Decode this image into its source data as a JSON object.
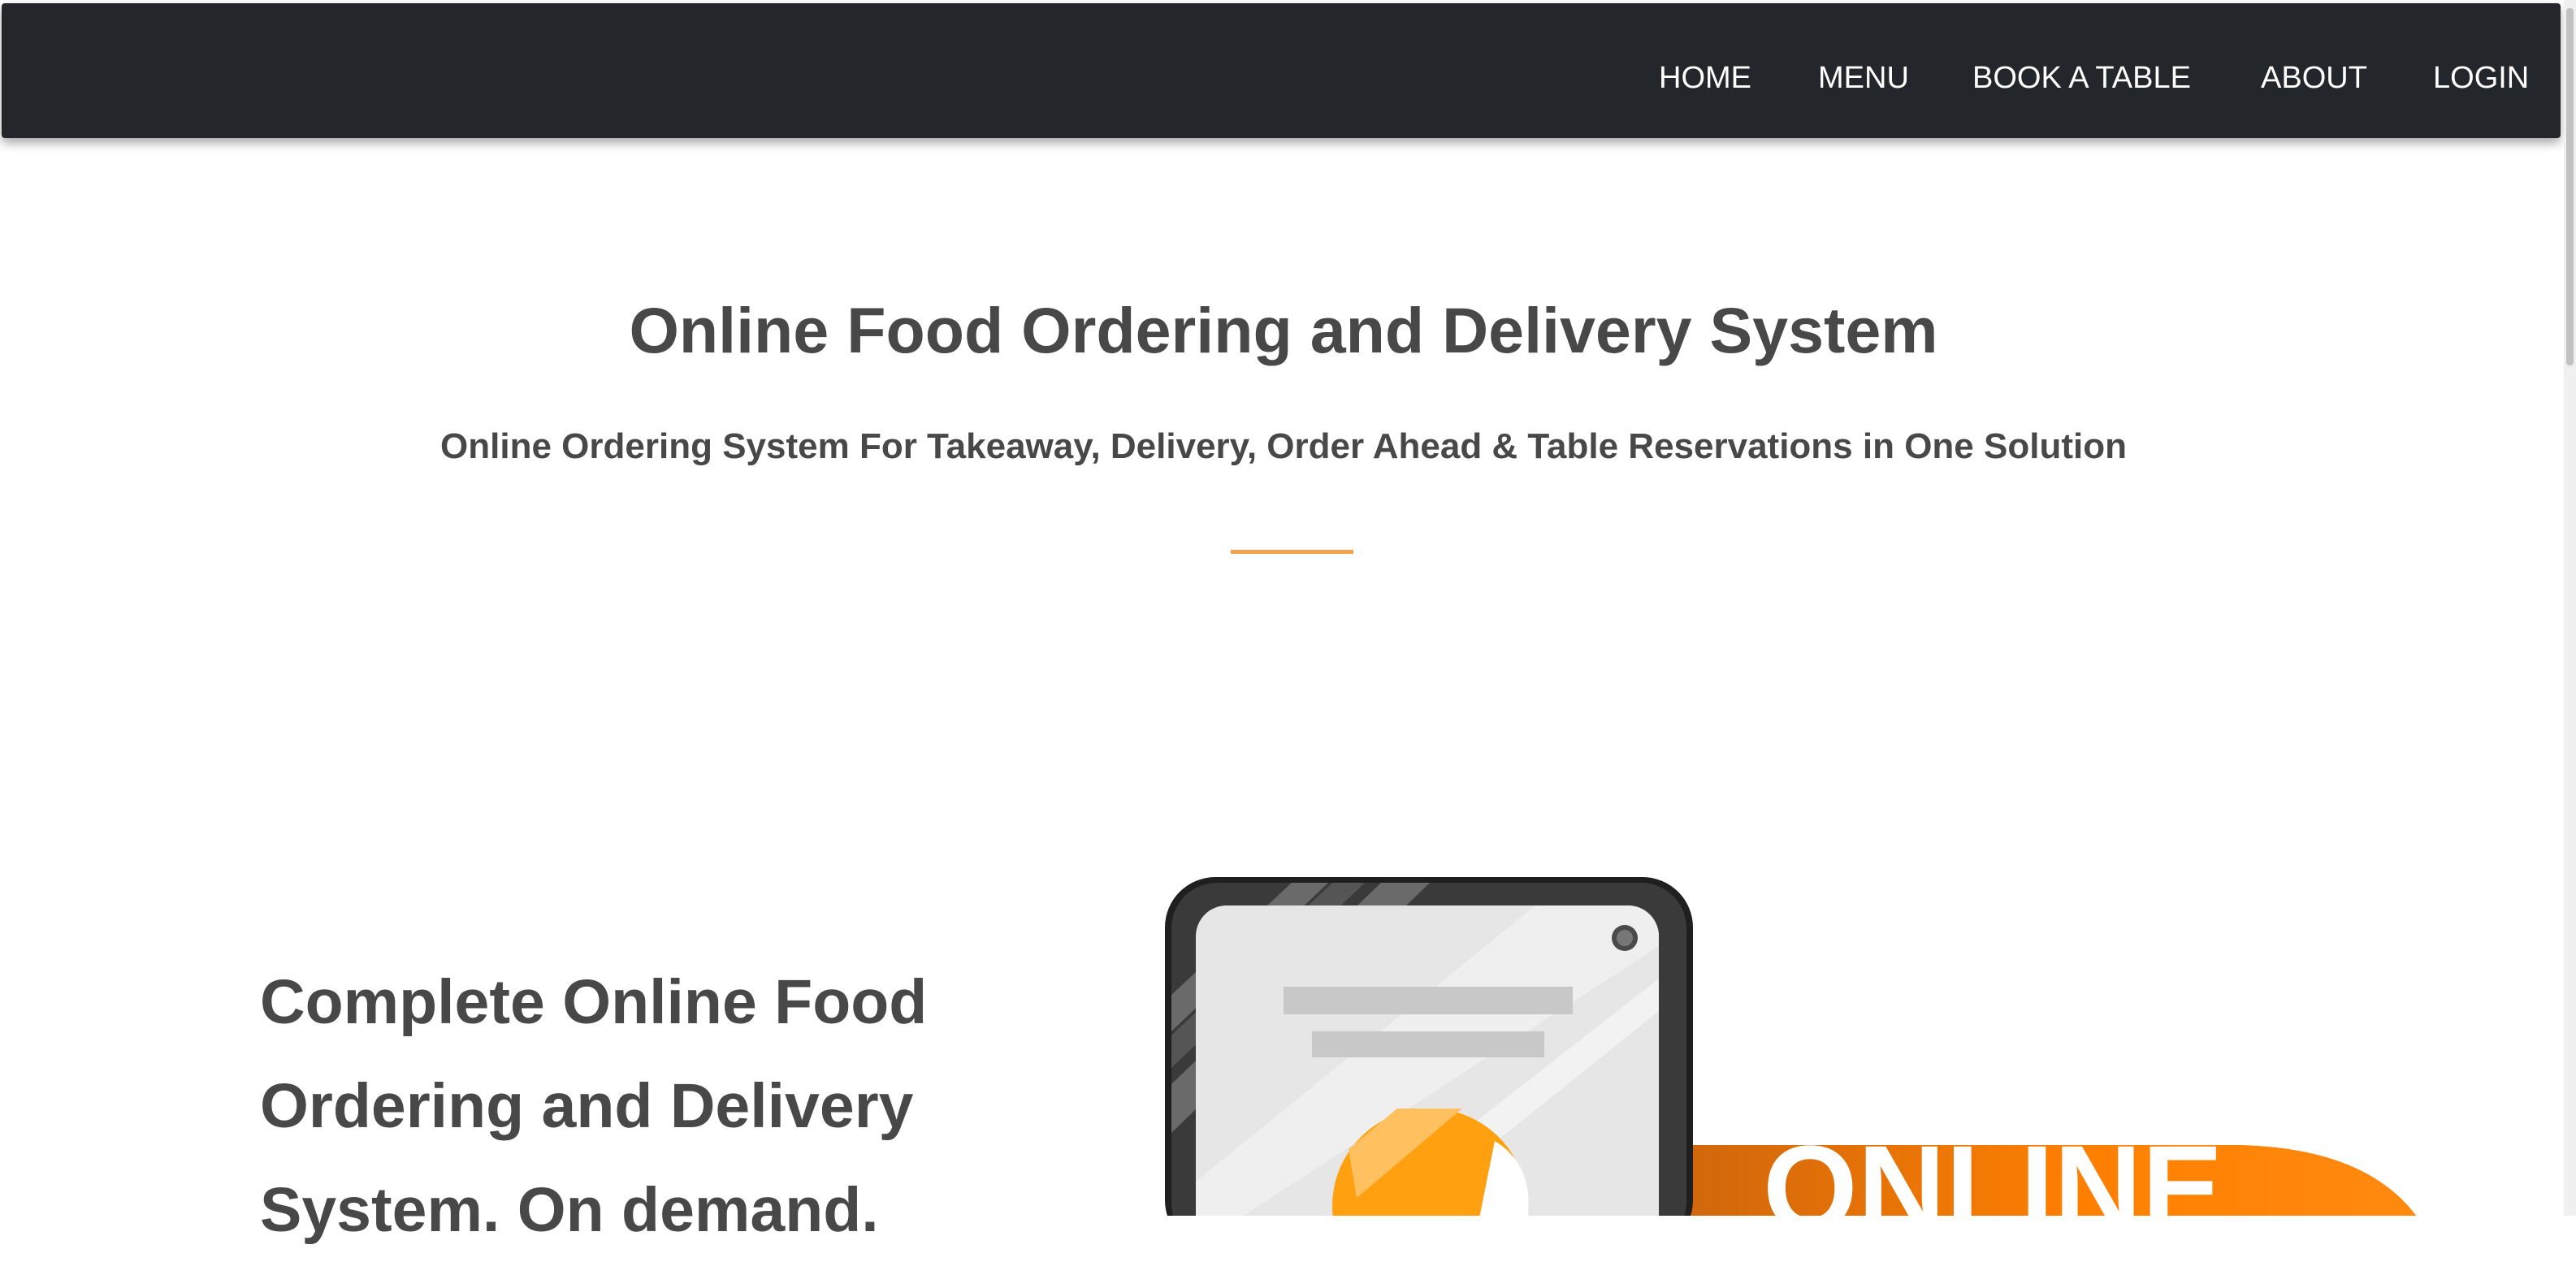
{
  "nav": {
    "items": [
      {
        "label": "HOME"
      },
      {
        "label": "MENU"
      },
      {
        "label": "BOOK A TABLE"
      },
      {
        "label": "ABOUT"
      },
      {
        "label": "LOGIN"
      }
    ]
  },
  "hero": {
    "title": "Online Food Ordering and Delivery System",
    "subtitle": "Online Ordering System For Takeaway, Delivery, Order Ahead & Table Reservations in One Solution"
  },
  "feature": {
    "heading_lines": [
      "Complete Online Food",
      "Ordering and Delivery",
      "System. On demand."
    ]
  },
  "illustration": {
    "banner_text": "ONLINE"
  },
  "colors": {
    "navbar_bg": "#23262a",
    "text_dark": "#484848",
    "accent_orange": "#f7a050",
    "banner_orange": "#ff8000"
  }
}
